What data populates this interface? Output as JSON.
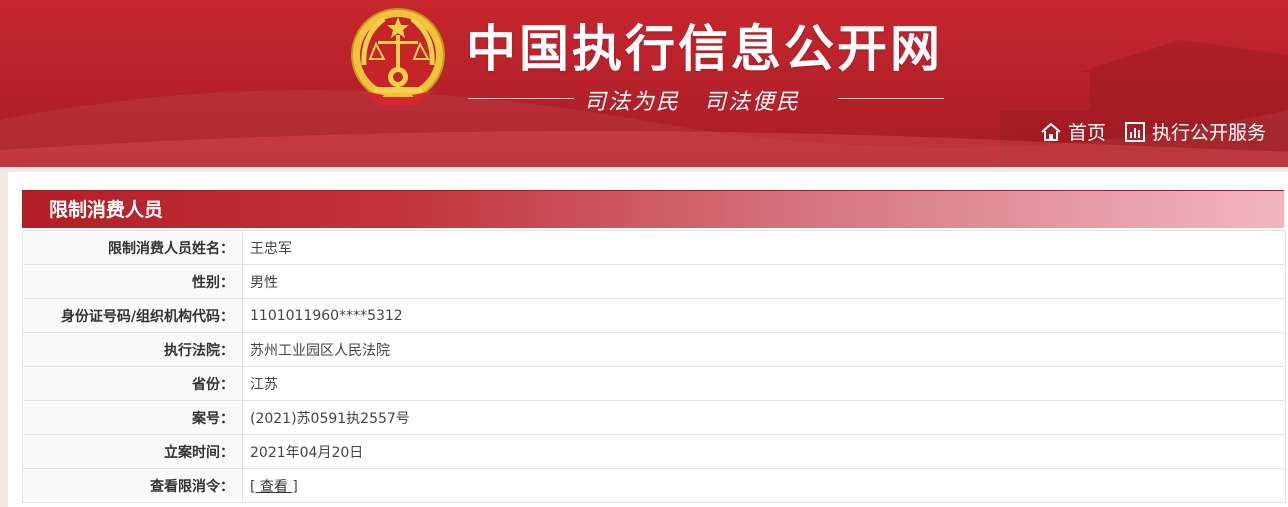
{
  "header": {
    "site_title": "中国执行信息公开网",
    "slogan": "司法为民　司法便民",
    "nav": [
      {
        "label": "首页",
        "icon": "home-icon"
      },
      {
        "label": "执行公开服务",
        "icon": "chart-icon"
      }
    ]
  },
  "panel": {
    "title": "限制消费人员",
    "rows": [
      {
        "label": "限制消费人员姓名：",
        "value": "王忠军"
      },
      {
        "label": "性别：",
        "value": "男性"
      },
      {
        "label": "身份证号码/组织机构代码：",
        "value": "1101011960****5312"
      },
      {
        "label": "执行法院：",
        "value": "苏州工业园区人民法院"
      },
      {
        "label": "省份：",
        "value": "江苏"
      },
      {
        "label": "案号：",
        "value": "(2021)苏0591执2557号"
      },
      {
        "label": "立案时间：",
        "value": "2021年04月20日"
      },
      {
        "label": "查看限消令：",
        "link_prefix": "[",
        "link_text": " 查看 ",
        "link_suffix": "]"
      }
    ]
  },
  "colors": {
    "header_red": "#b5212a",
    "emblem_gold": "#e8b930",
    "title_text": "#ffffff"
  }
}
